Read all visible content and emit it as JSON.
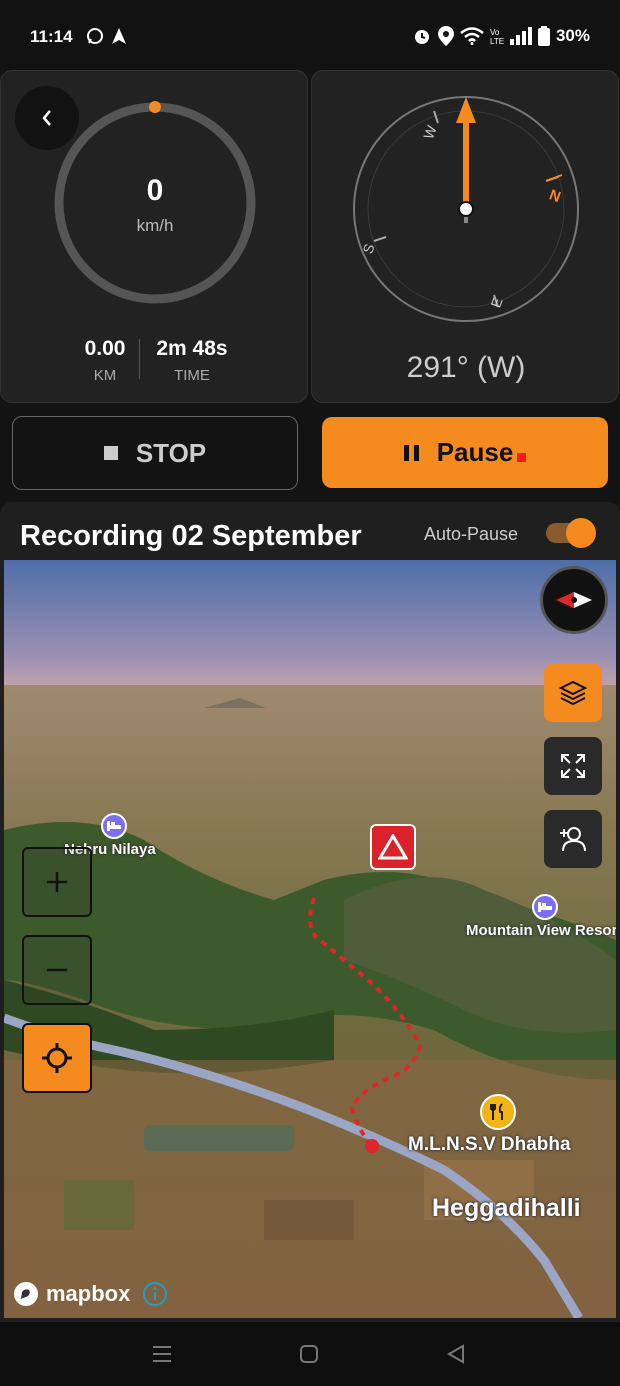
{
  "status_bar": {
    "time": "11:14",
    "battery": "30%",
    "icons": [
      "whatsapp-icon",
      "navigation-icon",
      "alarm-icon",
      "location-icon",
      "wifi-icon",
      "volte-icon",
      "signal-icon",
      "battery-icon"
    ]
  },
  "speed_card": {
    "speed": "0",
    "speed_unit": "km/h",
    "distance_value": "0.00",
    "distance_label": "KM",
    "time_value": "2m 48s",
    "time_label": "TIME"
  },
  "compass_card": {
    "heading": "291° (W)",
    "labels": {
      "n": "N",
      "e": "E",
      "s": "S",
      "w": "W"
    }
  },
  "controls": {
    "stop_label": "STOP",
    "pause_label": "Pause"
  },
  "recording": {
    "title": "Recording 02 September",
    "auto_pause_label": "Auto-Pause",
    "auto_pause_on": true
  },
  "map": {
    "labels": {
      "nehru": "Nehru Nilaya",
      "mountain": "Mountain View Resor",
      "dhaba": "M.L.N.S.V Dhabha",
      "village": "Heggadihalli"
    },
    "attribution": "mapbox"
  },
  "colors": {
    "accent": "#f58a1f",
    "record": "#ff1a1a",
    "route": "#e0262b"
  }
}
